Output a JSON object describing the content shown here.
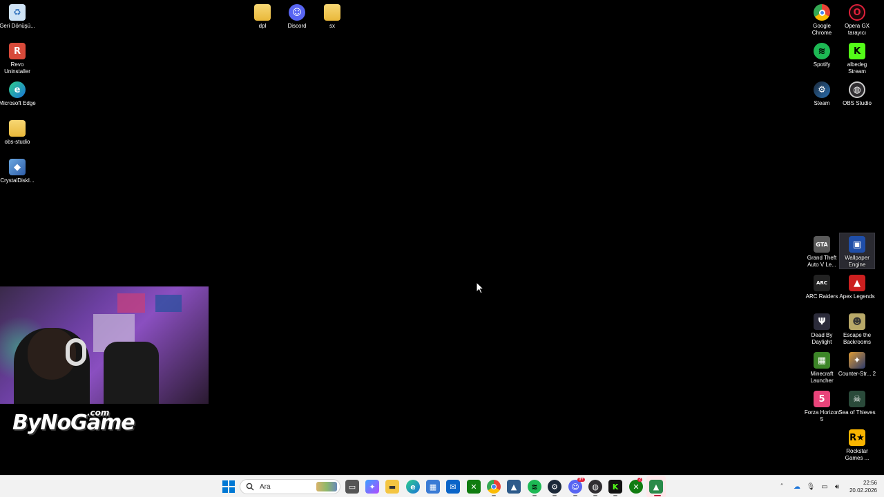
{
  "desktop": {
    "icons_left": [
      {
        "label": "Geri Dönüşü...",
        "icon": "recycle-bin-icon"
      },
      {
        "label": "Revo Uninstaller",
        "icon": "revo-uninstaller-icon"
      },
      {
        "label": "Microsoft Edge",
        "icon": "edge-icon"
      },
      {
        "label": "obs-studio",
        "icon": "folder-icon"
      },
      {
        "label": "CrystalDiskI...",
        "icon": "crystaldisk-icon"
      }
    ],
    "icons_top": [
      {
        "label": "dpl",
        "icon": "folder-icon"
      },
      {
        "label": "Discord",
        "icon": "discord-icon"
      },
      {
        "label": "sx",
        "icon": "folder-icon"
      }
    ],
    "icons_right_top": [
      {
        "label": "Google Chrome",
        "icon": "chrome-icon"
      },
      {
        "label": "Opera GX tarayıcı",
        "icon": "opera-gx-icon"
      },
      {
        "label": "Spotify",
        "icon": "spotify-icon"
      },
      {
        "label": "albedeg Stream",
        "icon": "kick-icon"
      },
      {
        "label": "Steam",
        "icon": "steam-icon"
      },
      {
        "label": "OBS Studio",
        "icon": "obs-icon"
      }
    ],
    "icons_right_bottom": [
      {
        "label": "Grand Theft Auto V Le...",
        "icon": "gta-icon"
      },
      {
        "label": "Wallpaper Engine",
        "icon": "wallpaper-engine-icon"
      },
      {
        "label": "ARC Raiders",
        "icon": "arc-raiders-icon"
      },
      {
        "label": "Apex Legends",
        "icon": "apex-icon"
      },
      {
        "label": "Dead By Daylight",
        "icon": "dbd-icon"
      },
      {
        "label": "Escape the Backrooms",
        "icon": "backrooms-icon"
      },
      {
        "label": "Minecraft Launcher",
        "icon": "minecraft-icon"
      },
      {
        "label": "Counter-Str... 2",
        "icon": "cs2-icon"
      },
      {
        "label": "Forza Horizon 5",
        "icon": "forza-icon"
      },
      {
        "label": "Sea of Thieves",
        "icon": "sea-of-thieves-icon"
      },
      {
        "label": "Rockstar Games ...",
        "icon": "rockstar-icon"
      }
    ]
  },
  "overlay": {
    "brand_main": "ByNoGame",
    "brand_suffix": ".com"
  },
  "taskbar": {
    "search_placeholder": "Ara",
    "discord_badge": "9+",
    "xbox_badge": "2",
    "clock_time": "22:56",
    "clock_date": "20.02.2026"
  }
}
